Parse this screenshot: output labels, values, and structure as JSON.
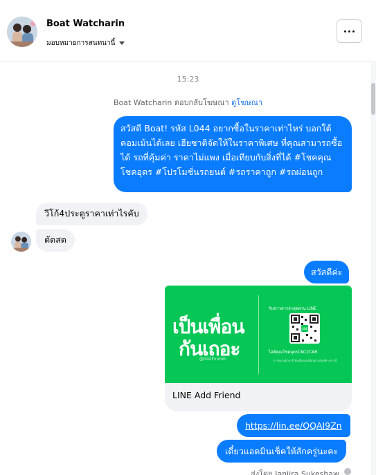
{
  "header": {
    "name": "Boat Watcharin",
    "assign_label": "มอบหมายการสนทนานี้",
    "more_icon": "more-horizontal-icon"
  },
  "thread": {
    "time": "15:23",
    "reply_note": "Boat Watcharin ตอบกลับโฆษณา",
    "reply_link": "ดูโฆษณา",
    "messages": {
      "ad_text": "สวัสดี Boat! รหัส L044 อยากซื้อในราคาเท่าไหร่ บอกใต้คอมเม้นได้เลย เฮียชาติจัดให้ในราคาพิเศษ ที่คุณสามารถซื้อได้ รถที่คุ้มค่า ราคาไม่แพง เมื่อเทียบกับสิ่งที่ได้ #โชคคุณโชคอุดร #โปรโมชั่นรถยนต์ #รถราคาถูก #รถผ่อนถูก",
      "in1": "วีโก้4ประตูราคาเท่าไรคับ",
      "in2": "ตัดสด",
      "hello": "สวัสดีค่ะ",
      "link": "https://lin.ee/QQAI9Zn",
      "last": "เดี๋ยวแอดมินเช็คให้สักครู่นะคะ"
    },
    "card": {
      "big_line1": "เป็นเพื่อน",
      "big_line2": "กันเถอะ",
      "handle": "@042Fvnmh",
      "right_heading": "รับข่าวสารล่าสุดผ่าน LINE",
      "right_id": "ไอดีคุณโชคอุดรCKC2CAR",
      "right_note": "การสแกนคิวอาร์โค้ดเพื่อแอดเพื่อนผ่านบัญชีทางการนี้",
      "title": "LINE Add Friend"
    },
    "sent_by": "ส่งโดย Janjira Sukeshaw"
  },
  "colors": {
    "outgoing_bubble": "#0a7cff",
    "incoming_bubble": "#f0f2f5",
    "line_green": "#06c755",
    "link_blue": "#1b74e4"
  }
}
